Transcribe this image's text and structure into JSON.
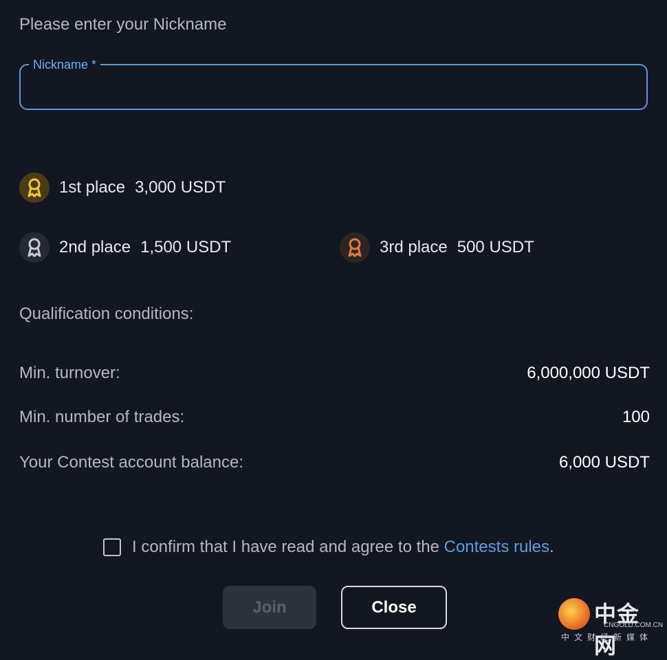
{
  "prompt": "Please enter your Nickname",
  "nickname_field": {
    "label": "Nickname *",
    "value": ""
  },
  "prizes": [
    {
      "place": "1st place",
      "amount": "3,000 USDT",
      "icon": "gold-medal-icon",
      "color": "#f5c542"
    },
    {
      "place": "2nd place",
      "amount": "1,500 USDT",
      "icon": "silver-medal-icon",
      "color": "#c9ccd2"
    },
    {
      "place": "3rd place",
      "amount": "500 USDT",
      "icon": "bronze-medal-icon",
      "color": "#e07a48"
    }
  ],
  "conditions": {
    "title": "Qualification conditions:",
    "rows": [
      {
        "label": "Min. turnover:",
        "value": "6,000,000 USDT"
      },
      {
        "label": "Min. number of trades:",
        "value": "100"
      },
      {
        "label": "Your Contest account balance:",
        "value": "6,000 USDT"
      }
    ]
  },
  "confirm": {
    "checked": false,
    "text": "I confirm that I have read and agree to the ",
    "link": "Contests rules",
    "suffix": "."
  },
  "buttons": {
    "join": "Join",
    "close": "Close"
  },
  "watermark": {
    "cn": "中金网",
    "en": "CNGOLD.COM.CN",
    "sub": "中文财经新媒体"
  },
  "colors": {
    "accent": "#5b9bd9",
    "link": "#5c9de0",
    "background": "#131722"
  }
}
